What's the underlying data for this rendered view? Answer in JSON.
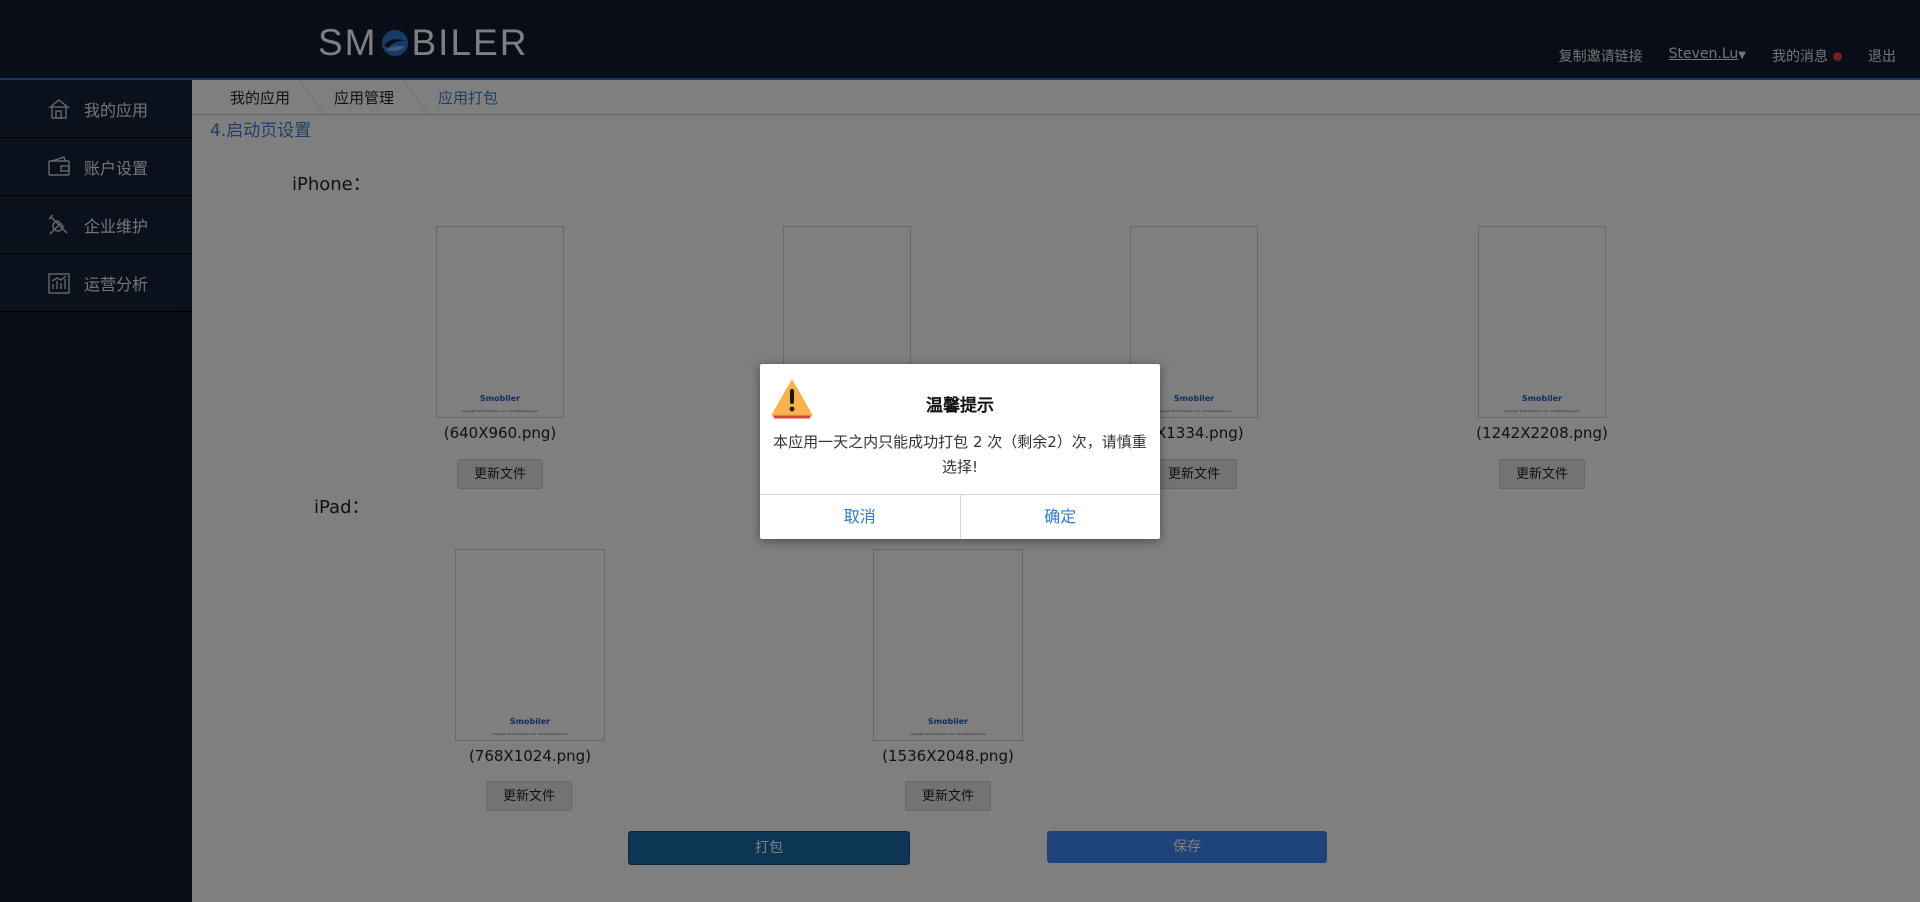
{
  "header": {
    "logo_left": "SM",
    "logo_right": "BILER",
    "links": {
      "invite": "复制邀请链接",
      "user": "Steven.Lu",
      "messages": "我的消息",
      "logout": "退出"
    }
  },
  "sidebar": {
    "items": [
      {
        "label": "我的应用",
        "icon": "home-icon"
      },
      {
        "label": "账户设置",
        "icon": "wallet-icon"
      },
      {
        "label": "企业维护",
        "icon": "tools-icon"
      },
      {
        "label": "运营分析",
        "icon": "chart-icon"
      }
    ]
  },
  "breadcrumb": [
    "我的应用",
    "应用管理",
    "应用打包"
  ],
  "section_title": "4.启动页设置",
  "iphone_label": "iPhone：",
  "ipad_label": "iPad：",
  "thumb_brand": "Smobiler",
  "thumb_copy": "Copyright 2018 Smobiler.com. All Rights Reserved.",
  "iphone_images": [
    {
      "caption": "(640X960.png)",
      "button": "更新文件"
    },
    {
      "caption": "",
      "button": ""
    },
    {
      "caption": "0X1334.png)",
      "button": "更新文件"
    },
    {
      "caption": "(1242X2208.png)",
      "button": "更新文件"
    }
  ],
  "ipad_images": [
    {
      "caption": "(768X1024.png)",
      "button": "更新文件"
    },
    {
      "caption": "(1536X2048.png)",
      "button": "更新文件"
    }
  ],
  "actions": {
    "pack": "打包",
    "save": "保存"
  },
  "dialog": {
    "title": "温馨提示",
    "message": "本应用一天之内只能成功打包 2 次（剩余2）次，请慎重选择!",
    "cancel": "取消",
    "confirm": "确定"
  },
  "colors": {
    "topbar": "#121b2e",
    "accent": "#3c7ec5",
    "save": "#3c86f0",
    "pack": "#1b6ca8",
    "dot": "#d9423e"
  }
}
